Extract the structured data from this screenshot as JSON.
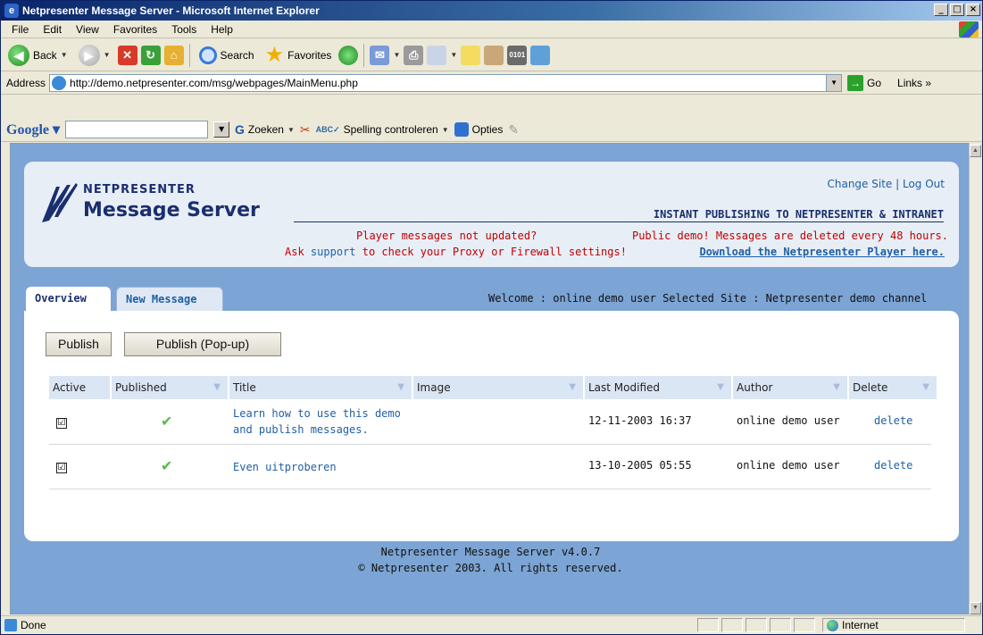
{
  "window": {
    "title": "Netpresenter Message Server - Microsoft Internet Explorer",
    "min": "_",
    "max": "□",
    "close": "×"
  },
  "menu": [
    "File",
    "Edit",
    "View",
    "Favorites",
    "Tools",
    "Help"
  ],
  "toolbar": {
    "back": "Back",
    "search": "Search",
    "favorites": "Favorites"
  },
  "address": {
    "label": "Address",
    "url": "http://demo.netpresenter.com/msg/webpages/MainMenu.php",
    "go": "Go",
    "links": "Links"
  },
  "google": {
    "logo": "Google",
    "zoeken": "Zoeken",
    "spelling": "Spelling controleren",
    "opties": "Opties"
  },
  "header": {
    "brand": "NETPRESENTER",
    "product": "Message Server",
    "change_site": "Change Site",
    "separator": "|",
    "log_out": "Log Out",
    "tagline": "INSTANT PUBLISHING TO NETPRESENTER & INTRANET",
    "warn_line1": "Player messages not updated?",
    "warn_ask": "Ask",
    "warn_support": "support",
    "warn_rest": "to check your Proxy or Firewall settings!",
    "public_demo": "Public demo! Messages are deleted every 48 hours.",
    "download": "Download the Netpresenter Player here."
  },
  "tabs": {
    "overview": "Overview",
    "new_message": "New Message",
    "welcome": "Welcome : online demo user   Selected Site : Netpresenter demo channel"
  },
  "buttons": {
    "publish": "Publish",
    "publish_popup": "Publish (Pop-up)"
  },
  "table": {
    "headers": [
      "Active",
      "Published",
      "Title",
      "Image",
      "Last Modified",
      "Author",
      "Delete"
    ],
    "rows": [
      {
        "active": "☑",
        "published": "✔",
        "title_line1": "Learn how to use this demo",
        "title_line2": "and publish messages.",
        "image": "",
        "modified": "12-11-2003 16:37",
        "author": "online demo user",
        "delete": "delete"
      },
      {
        "active": "☑",
        "published": "✔",
        "title_line1": "Even uitproberen",
        "title_line2": "",
        "image": "",
        "modified": "13-10-2005 05:55",
        "author": "online demo user",
        "delete": "delete"
      }
    ]
  },
  "footer": {
    "line1": "Netpresenter Message Server v4.0.7",
    "line2": "© Netpresenter 2003. All rights reserved."
  },
  "status": {
    "done": "Done",
    "zone": "Internet"
  }
}
